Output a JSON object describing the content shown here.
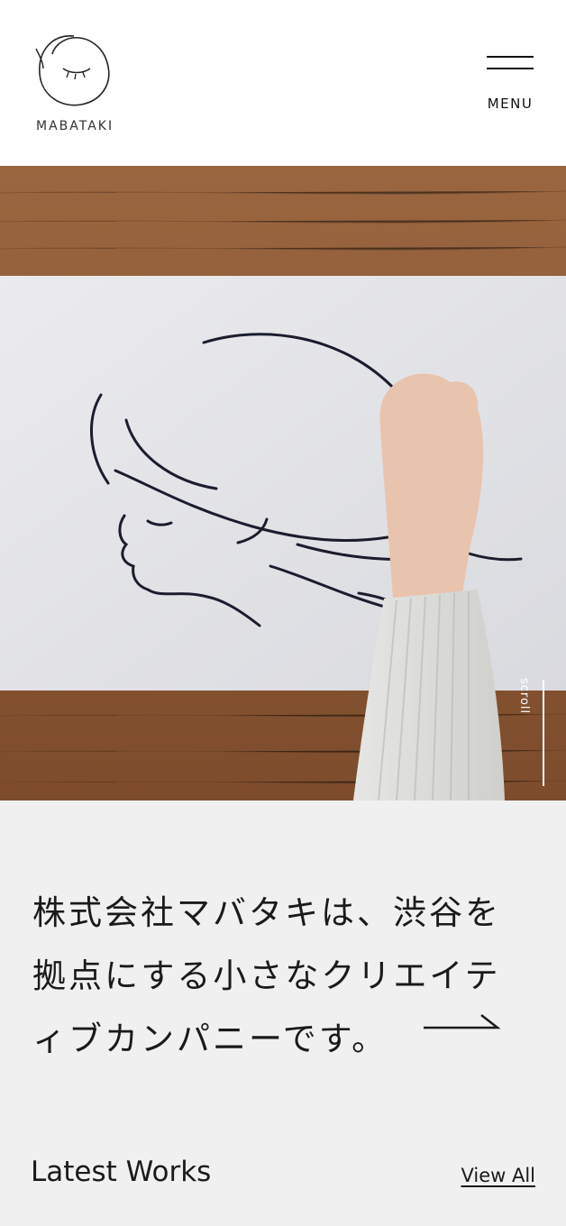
{
  "header": {
    "logo_text": "MABATAKI",
    "menu_label": "MENU"
  },
  "hero": {
    "scroll_label": "scroll"
  },
  "intro": {
    "text": "株式会社マバタキは、渋谷を拠点にする小さなクリエイティブカンパニーです。"
  },
  "works": {
    "title": "Latest Works",
    "view_all": "View All"
  },
  "colors": {
    "background": "#f0f0f0",
    "header_bg": "#ffffff",
    "text": "#1a1a1a",
    "wood": "#8d5a36",
    "paper": "#e7e7e9"
  }
}
